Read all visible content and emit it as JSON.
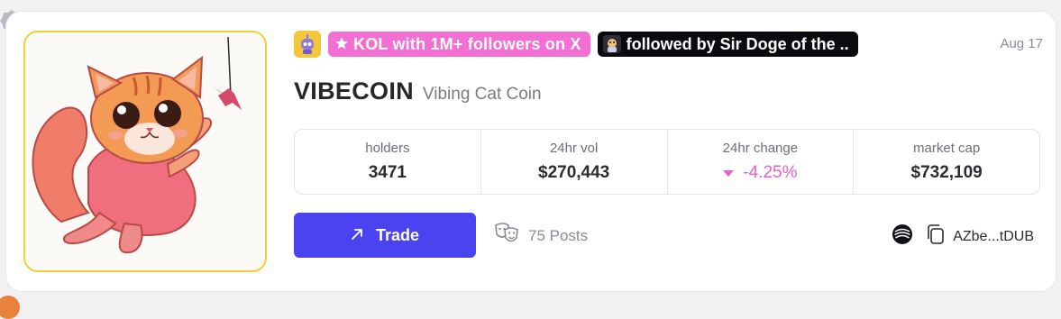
{
  "badges": {
    "kol_label": "KOL with 1M+ followers on X",
    "followed_label": "followed by Sir Doge of the .."
  },
  "date": "Aug 17",
  "coin": {
    "ticker": "VIBECOIN",
    "name": "Vibing Cat Coin"
  },
  "stats": [
    {
      "label": "holders",
      "value": "3471"
    },
    {
      "label": "24hr vol",
      "value": "$270,443"
    },
    {
      "label": "24hr change",
      "value": "-4.25%"
    },
    {
      "label": "market cap",
      "value": "$732,109"
    }
  ],
  "actions": {
    "trade_label": "Trade",
    "posts_label": "75 Posts",
    "address_label": "AZbe...tDUB"
  },
  "colors": {
    "accent": "#4a43ef",
    "pink_tag": "#f36fd3",
    "negative": "#e85fc9",
    "thumb_border": "#eed13a"
  },
  "icons": {
    "corner": "gear-badge-icon",
    "avatar": "robot-avatar-icon",
    "star": "star-icon",
    "trade": "arrow-up-right-icon",
    "posts": "theater-masks-icon",
    "network": "swirl-network-icon",
    "copy": "copy-icon",
    "change": "triangle-down-icon"
  }
}
